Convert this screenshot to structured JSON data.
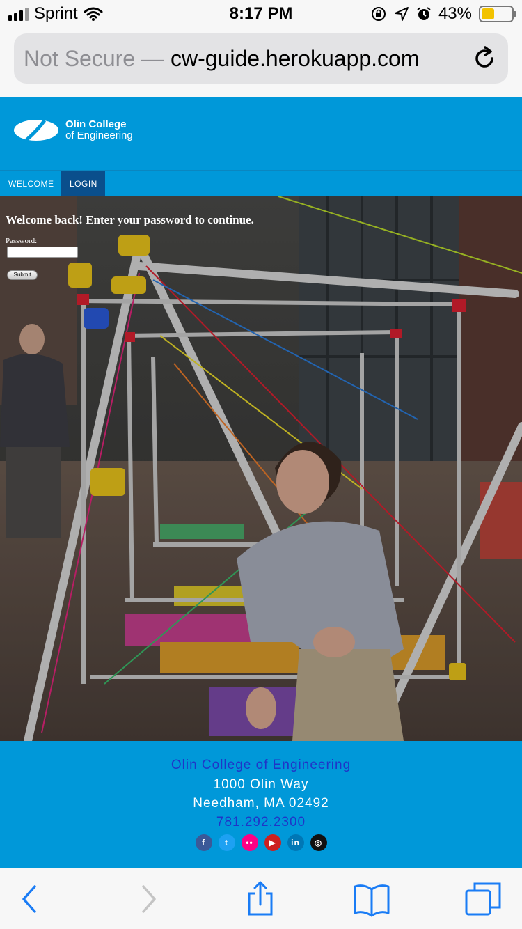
{
  "status_bar": {
    "carrier": "Sprint",
    "time": "8:17 PM",
    "battery": "43%",
    "battery_level": 0.43
  },
  "browser": {
    "insecure_label": "Not Secure —",
    "host": "cw-guide.herokuapp.com"
  },
  "header": {
    "logo_line1": "Olin College",
    "logo_line2": "of Engineering"
  },
  "nav": {
    "items": [
      {
        "label": "WELCOME"
      },
      {
        "label": "LOGIN"
      }
    ]
  },
  "login": {
    "message": "Welcome back! Enter your password to continue.",
    "password_label": "Password:",
    "password_value": "",
    "submit_label": "Submit"
  },
  "footer": {
    "name": "Olin College of Engineering",
    "address1": "1000 Olin Way",
    "address2": "Needham, MA 02492",
    "phone": "781.292.2300",
    "social": [
      {
        "icon": "facebook-icon",
        "glyph": "f",
        "color": "#3b5998"
      },
      {
        "icon": "twitter-icon",
        "glyph": "t",
        "color": "#1da1f2"
      },
      {
        "icon": "flickr-icon",
        "glyph": "••",
        "color": "#ff0084"
      },
      {
        "icon": "youtube-icon",
        "glyph": "▶",
        "color": "#cd201f"
      },
      {
        "icon": "linkedin-icon",
        "glyph": "in",
        "color": "#0077b5"
      },
      {
        "icon": "instagram-icon",
        "glyph": "◎",
        "color": "#111111"
      }
    ]
  }
}
